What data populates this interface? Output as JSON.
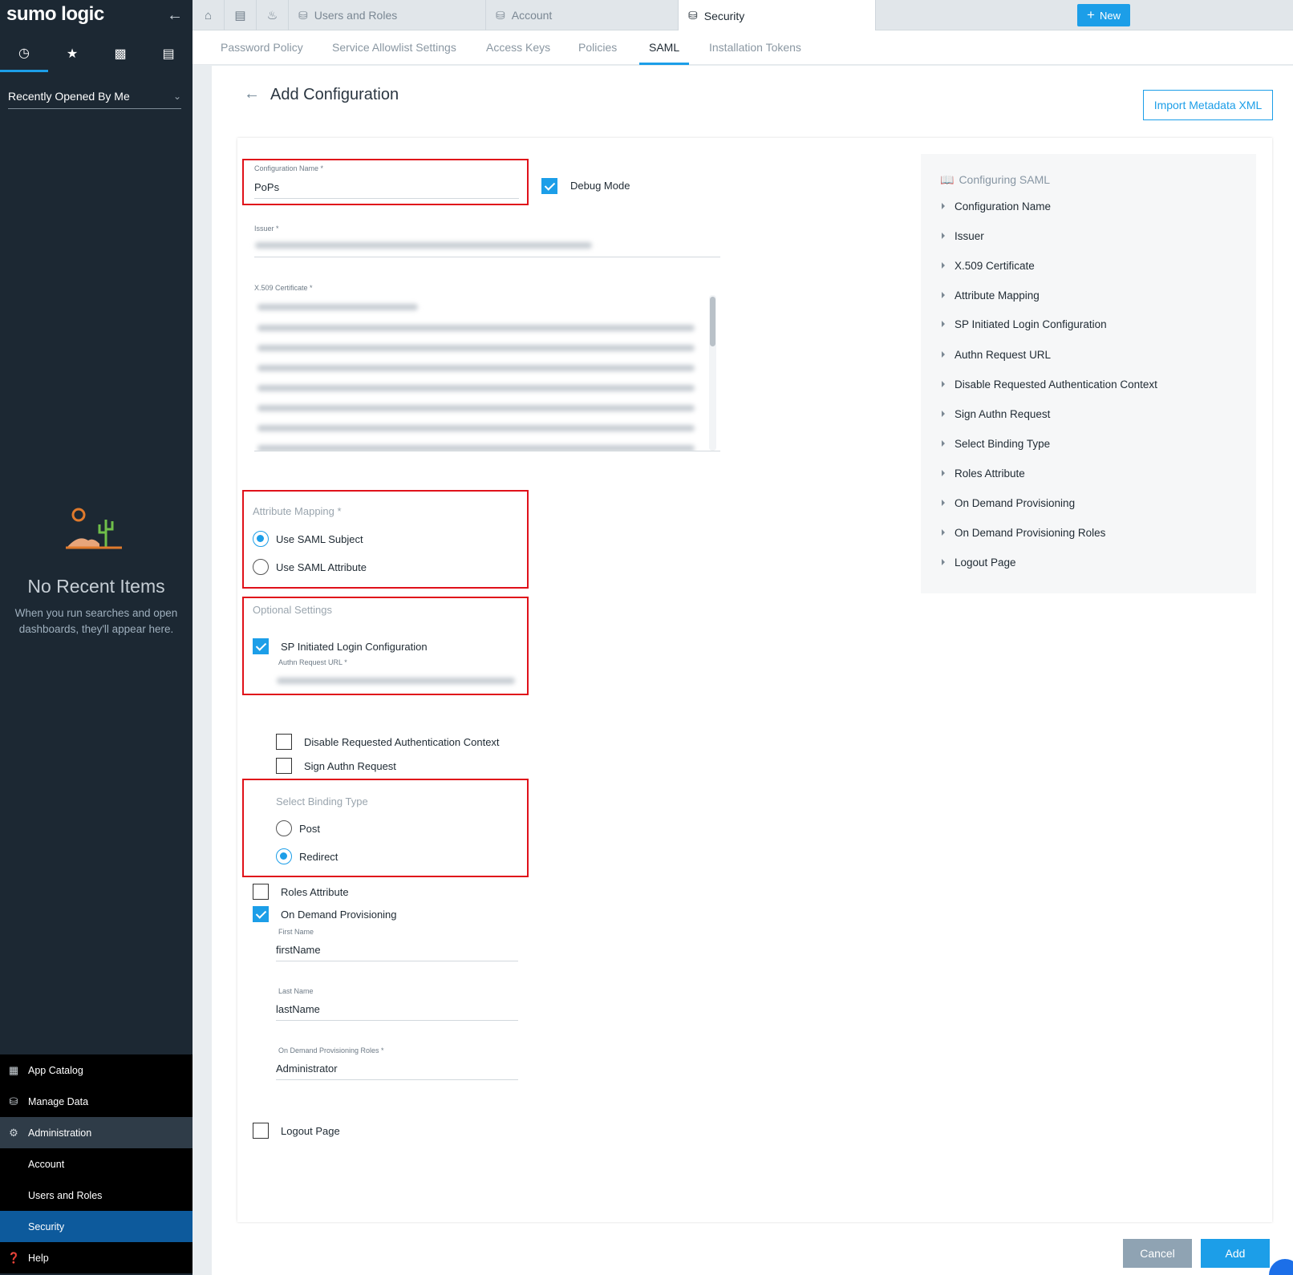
{
  "sidebar": {
    "brand": "sumo logic",
    "recent_label": "Recently Opened By Me",
    "empty_title": "No Recent Items",
    "empty_desc": "When you run searches and open dashboards, they'll appear here.",
    "nav": [
      {
        "label": "App Catalog",
        "icon": "grid-icon"
      },
      {
        "label": "Manage Data",
        "icon": "database-icon"
      },
      {
        "label": "Administration",
        "icon": "gear-icon"
      },
      {
        "label": "Account"
      },
      {
        "label": "Users and Roles"
      },
      {
        "label": "Security"
      },
      {
        "label": "Help",
        "icon": "question-icon"
      }
    ]
  },
  "tabs": {
    "items": [
      "Users and Roles",
      "Account",
      "Security"
    ],
    "new_label": "New"
  },
  "subnav": [
    "Password Policy",
    "Service Allowlist Settings",
    "Access Keys",
    "Policies",
    "SAML",
    "Installation Tokens"
  ],
  "page": {
    "title": "Add Configuration",
    "import_label": "Import Metadata XML"
  },
  "form": {
    "config_name_label": "Configuration Name *",
    "config_name_value": "PoPs",
    "debug_mode_label": "Debug Mode",
    "issuer_label": "Issuer *",
    "cert_label": "X.509 Certificate *",
    "attr_mapping_label": "Attribute Mapping *",
    "use_saml_subject": "Use SAML Subject",
    "use_saml_attribute": "Use SAML Attribute",
    "optional_settings_label": "Optional Settings",
    "sp_initiated_label": "SP Initiated Login Configuration",
    "authn_request_url_label": "Authn Request URL *",
    "disable_requested_label": "Disable Requested Authentication Context",
    "sign_authn_label": "Sign Authn Request",
    "binding_type_label": "Select Binding Type",
    "post_label": "Post",
    "redirect_label": "Redirect",
    "roles_attribute_label": "Roles Attribute",
    "on_demand_label": "On Demand Provisioning",
    "first_name_label": "First Name",
    "first_name_value": "firstName",
    "last_name_label": "Last Name",
    "last_name_value": "lastName",
    "odp_roles_label": "On Demand Provisioning Roles *",
    "odp_roles_value": "Administrator",
    "logout_page_label": "Logout Page"
  },
  "help": {
    "title": "Configuring SAML",
    "items": [
      "Configuration Name",
      "Issuer",
      "X.509 Certificate",
      "Attribute Mapping",
      "SP Initiated Login Configuration",
      "Authn Request URL",
      "Disable Requested Authentication Context",
      "Sign Authn Request",
      "Select Binding Type",
      "Roles Attribute",
      "On Demand Provisioning",
      "On Demand Provisioning Roles",
      "Logout Page"
    ]
  },
  "footer": {
    "cancel_label": "Cancel",
    "add_label": "Add"
  },
  "colors": {
    "accent": "#1c9ee8",
    "highlight": "#e0111a",
    "sidebar_bg": "#1c2833",
    "active_nav": "#0d5a9c"
  }
}
